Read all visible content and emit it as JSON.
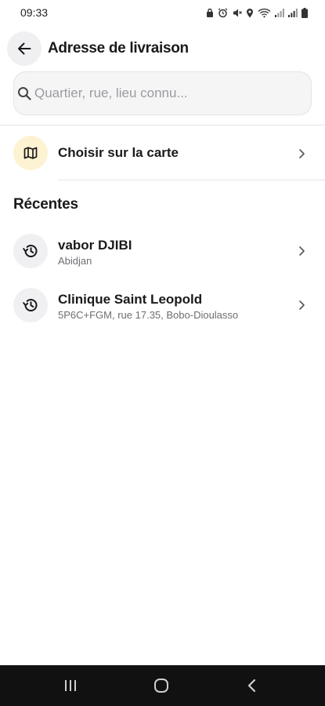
{
  "status_bar": {
    "time": "09:33",
    "icons": [
      "lock-icon",
      "alarm-icon",
      "mute-icon",
      "location-icon",
      "wifi-icon",
      "signal-icon",
      "signal-icon",
      "battery-icon"
    ]
  },
  "header": {
    "title": "Adresse de livraison",
    "back_icon": "arrow-left-icon"
  },
  "search": {
    "placeholder": "Quartier, rue, lieu connu...",
    "value": ""
  },
  "map_option": {
    "label": "Choisir sur la carte",
    "icon": "map-icon",
    "icon_background": "#fdf3d2"
  },
  "recent": {
    "title": "Récentes",
    "items": [
      {
        "name": "vabor DJIBI",
        "detail": "Abidjan",
        "icon": "history-icon"
      },
      {
        "name": "Clinique Saint Leopold",
        "detail": "5P6C+FGM, rue 17.35, Bobo-Dioulasso",
        "icon": "history-icon"
      }
    ]
  },
  "nav_bar": {
    "buttons": [
      "recent-apps-icon",
      "home-icon",
      "back-icon"
    ]
  }
}
